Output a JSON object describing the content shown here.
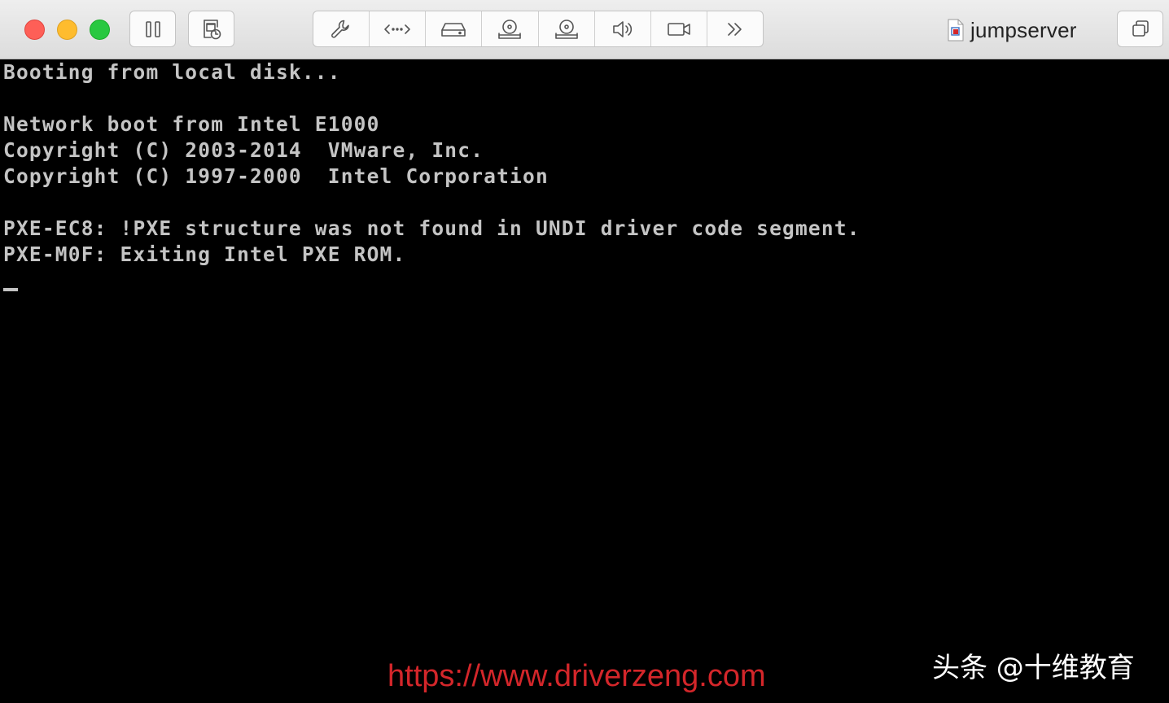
{
  "window": {
    "title": "jumpserver",
    "controls": [
      "close",
      "minimize",
      "zoom"
    ]
  },
  "toolbar": {
    "left_buttons": [
      {
        "icon": "pause-icon",
        "label": "Pause"
      },
      {
        "icon": "snapshot-icon",
        "label": "Snapshots"
      }
    ],
    "group_buttons": [
      {
        "icon": "wrench-icon"
      },
      {
        "icon": "code-arrows-icon"
      },
      {
        "icon": "hard-disk-icon"
      },
      {
        "icon": "optical-drive-icon"
      },
      {
        "icon": "optical-drive-icon"
      },
      {
        "icon": "speaker-icon"
      },
      {
        "icon": "camera-icon"
      },
      {
        "icon": "chevron-double-right-icon"
      }
    ],
    "right_button": {
      "icon": "window-restore-icon"
    }
  },
  "console": {
    "lines": [
      "Booting from local disk...",
      "",
      "Network boot from Intel E1000",
      "Copyright (C) 2003-2014  VMware, Inc.",
      "Copyright (C) 1997-2000  Intel Corporation",
      "",
      "PXE-EC8: !PXE structure was not found in UNDI driver code segment.",
      "PXE-M0F: Exiting Intel PXE ROM."
    ],
    "cursor": "_"
  },
  "watermark": {
    "url": "https://www.driverzeng.com",
    "brand": "头条 @十维教育"
  },
  "colors": {
    "console_background": "#000000",
    "console_text": "#c4c4c4",
    "watermark_url": "#d3262a",
    "close": "#fe5f57",
    "minimize": "#febc2e",
    "zoom": "#28c840"
  }
}
